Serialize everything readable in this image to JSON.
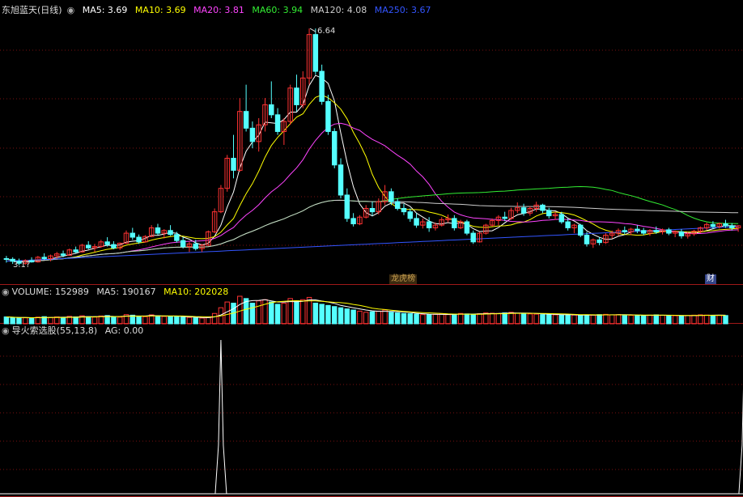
{
  "main_panel": {
    "stock_title": "东旭蓝天(日线)",
    "indicators": [
      {
        "label": "MA5: 3.69",
        "color": "#ffffff"
      },
      {
        "label": "MA10: 3.69",
        "color": "#ffff00"
      },
      {
        "label": "MA20: 3.81",
        "color": "#ff44ff"
      },
      {
        "label": "MA60: 3.94",
        "color": "#33ee33"
      },
      {
        "label": "MA120: 4.08",
        "color": "#cccccc"
      },
      {
        "label": "MA250: 3.67",
        "color": "#3355ff"
      }
    ],
    "high_label": "6.64",
    "low_label": "3.1?",
    "event_tags": [
      {
        "text": "龙虎榜",
        "bar": 62,
        "color": "#c8a050",
        "bg": "#3a2a10"
      },
      {
        "text": "财",
        "bar": 112,
        "color": "#ffffff",
        "bg": "#334488"
      }
    ]
  },
  "volume_panel": {
    "label": "VOLUME: 152989",
    "ma5": "MA5: 190167",
    "ma10": "MA10: 202028"
  },
  "indicator_panel": {
    "label": "导火索选股(55,13,8)",
    "value": "AG: 0.00"
  },
  "colors": {
    "up": "#ff3333",
    "down": "#55ffff",
    "grid": "#7a1010",
    "ag_line": "#ffffff"
  },
  "chart_data": {
    "type": "candlestick",
    "ohlc": [
      [
        3.2,
        3.24,
        3.14,
        3.19
      ],
      [
        3.19,
        3.22,
        3.12,
        3.16
      ],
      [
        3.16,
        3.2,
        3.1,
        3.13
      ],
      [
        3.13,
        3.19,
        3.11,
        3.17
      ],
      [
        3.17,
        3.22,
        3.14,
        3.15
      ],
      [
        3.15,
        3.24,
        3.14,
        3.22
      ],
      [
        3.22,
        3.28,
        3.18,
        3.2
      ],
      [
        3.2,
        3.26,
        3.16,
        3.24
      ],
      [
        3.24,
        3.3,
        3.2,
        3.27
      ],
      [
        3.27,
        3.32,
        3.22,
        3.25
      ],
      [
        3.25,
        3.35,
        3.24,
        3.33
      ],
      [
        3.33,
        3.38,
        3.28,
        3.3
      ],
      [
        3.3,
        3.42,
        3.29,
        3.4
      ],
      [
        3.4,
        3.46,
        3.34,
        3.36
      ],
      [
        3.36,
        3.42,
        3.3,
        3.38
      ],
      [
        3.38,
        3.48,
        3.36,
        3.45
      ],
      [
        3.45,
        3.52,
        3.38,
        3.41
      ],
      [
        3.41,
        3.46,
        3.34,
        3.36
      ],
      [
        3.36,
        3.44,
        3.33,
        3.43
      ],
      [
        3.43,
        3.62,
        3.42,
        3.58
      ],
      [
        3.58,
        3.66,
        3.48,
        3.52
      ],
      [
        3.52,
        3.56,
        3.42,
        3.45
      ],
      [
        3.45,
        3.55,
        3.44,
        3.53
      ],
      [
        3.53,
        3.7,
        3.52,
        3.66
      ],
      [
        3.66,
        3.72,
        3.55,
        3.58
      ],
      [
        3.58,
        3.64,
        3.5,
        3.62
      ],
      [
        3.62,
        3.7,
        3.54,
        3.56
      ],
      [
        3.56,
        3.6,
        3.44,
        3.47
      ],
      [
        3.47,
        3.52,
        3.35,
        3.38
      ],
      [
        3.38,
        3.45,
        3.3,
        3.42
      ],
      [
        3.42,
        3.48,
        3.32,
        3.35
      ],
      [
        3.35,
        3.42,
        3.3,
        3.4
      ],
      [
        3.4,
        3.62,
        3.39,
        3.6
      ],
      [
        3.6,
        3.95,
        3.58,
        3.9
      ],
      [
        3.9,
        4.3,
        3.88,
        4.25
      ],
      [
        4.25,
        4.75,
        4.2,
        4.7
      ],
      [
        4.7,
        5.05,
        4.4,
        4.52
      ],
      [
        4.52,
        5.6,
        4.5,
        5.4
      ],
      [
        5.4,
        5.8,
        5.1,
        5.15
      ],
      [
        5.15,
        5.25,
        4.85,
        4.95
      ],
      [
        4.95,
        5.3,
        4.8,
        5.2
      ],
      [
        5.2,
        5.6,
        5.1,
        5.5
      ],
      [
        5.5,
        5.85,
        5.3,
        5.35
      ],
      [
        5.35,
        5.45,
        5.05,
        5.1
      ],
      [
        5.1,
        5.3,
        4.9,
        5.25
      ],
      [
        5.25,
        5.8,
        5.2,
        5.75
      ],
      [
        5.75,
        5.95,
        5.4,
        5.5
      ],
      [
        5.5,
        6.0,
        5.45,
        5.9
      ],
      [
        5.9,
        6.64,
        5.8,
        6.55
      ],
      [
        6.55,
        6.64,
        5.95,
        6.0
      ],
      [
        6.0,
        6.1,
        5.5,
        5.55
      ],
      [
        5.55,
        5.65,
        5.05,
        5.1
      ],
      [
        5.1,
        5.15,
        4.55,
        4.6
      ],
      [
        4.6,
        4.7,
        4.1,
        4.15
      ],
      [
        4.15,
        4.25,
        3.75,
        3.8
      ],
      [
        3.8,
        3.88,
        3.68,
        3.72
      ],
      [
        3.72,
        3.85,
        3.7,
        3.82
      ],
      [
        3.82,
        4.0,
        3.8,
        3.95
      ],
      [
        3.95,
        4.05,
        3.84,
        3.9
      ],
      [
        3.9,
        4.1,
        3.86,
        4.05
      ],
      [
        4.05,
        4.3,
        4.0,
        4.2
      ],
      [
        4.2,
        4.25,
        4.0,
        4.05
      ],
      [
        4.05,
        4.1,
        3.92,
        3.95
      ],
      [
        3.95,
        4.02,
        3.85,
        3.9
      ],
      [
        3.9,
        3.95,
        3.75,
        3.8
      ],
      [
        3.8,
        3.88,
        3.66,
        3.7
      ],
      [
        3.7,
        3.8,
        3.65,
        3.75
      ],
      [
        3.75,
        3.82,
        3.6,
        3.66
      ],
      [
        3.66,
        3.74,
        3.62,
        3.7
      ],
      [
        3.7,
        3.82,
        3.68,
        3.78
      ],
      [
        3.78,
        3.86,
        3.74,
        3.8
      ],
      [
        3.8,
        3.85,
        3.62,
        3.66
      ],
      [
        3.66,
        3.78,
        3.64,
        3.75
      ],
      [
        3.75,
        3.78,
        3.55,
        3.58
      ],
      [
        3.58,
        3.62,
        3.42,
        3.45
      ],
      [
        3.45,
        3.6,
        3.44,
        3.58
      ],
      [
        3.58,
        3.72,
        3.56,
        3.7
      ],
      [
        3.7,
        3.8,
        3.68,
        3.77
      ],
      [
        3.77,
        3.85,
        3.7,
        3.82
      ],
      [
        3.82,
        3.9,
        3.76,
        3.8
      ],
      [
        3.8,
        3.96,
        3.78,
        3.92
      ],
      [
        3.92,
        4.04,
        3.88,
        3.96
      ],
      [
        3.96,
        4.02,
        3.84,
        3.88
      ],
      [
        3.88,
        3.98,
        3.84,
        3.95
      ],
      [
        3.95,
        4.05,
        3.9,
        4.0
      ],
      [
        4.0,
        4.02,
        3.88,
        3.92
      ],
      [
        3.92,
        3.96,
        3.8,
        3.84
      ],
      [
        3.84,
        3.9,
        3.78,
        3.86
      ],
      [
        3.86,
        3.9,
        3.72,
        3.75
      ],
      [
        3.75,
        3.8,
        3.62,
        3.66
      ],
      [
        3.66,
        3.72,
        3.58,
        3.7
      ],
      [
        3.7,
        3.72,
        3.52,
        3.55
      ],
      [
        3.55,
        3.6,
        3.38,
        3.42
      ],
      [
        3.42,
        3.5,
        3.36,
        3.48
      ],
      [
        3.48,
        3.52,
        3.4,
        3.44
      ],
      [
        3.44,
        3.58,
        3.42,
        3.55
      ],
      [
        3.55,
        3.62,
        3.5,
        3.58
      ],
      [
        3.58,
        3.65,
        3.54,
        3.62
      ],
      [
        3.62,
        3.68,
        3.56,
        3.6
      ],
      [
        3.6,
        3.66,
        3.55,
        3.64
      ],
      [
        3.64,
        3.7,
        3.58,
        3.62
      ],
      [
        3.62,
        3.66,
        3.55,
        3.58
      ],
      [
        3.58,
        3.64,
        3.54,
        3.62
      ],
      [
        3.62,
        3.68,
        3.57,
        3.6
      ],
      [
        3.6,
        3.65,
        3.56,
        3.63
      ],
      [
        3.63,
        3.66,
        3.55,
        3.58
      ],
      [
        3.58,
        3.62,
        3.52,
        3.6
      ],
      [
        3.6,
        3.64,
        3.5,
        3.54
      ],
      [
        3.54,
        3.6,
        3.5,
        3.57
      ],
      [
        3.57,
        3.63,
        3.54,
        3.61
      ],
      [
        3.61,
        3.68,
        3.58,
        3.66
      ],
      [
        3.66,
        3.74,
        3.63,
        3.71
      ],
      [
        3.71,
        3.76,
        3.64,
        3.68
      ],
      [
        3.68,
        3.74,
        3.65,
        3.72
      ],
      [
        3.72,
        3.78,
        3.66,
        3.69
      ],
      [
        3.69,
        3.73,
        3.62,
        3.66
      ],
      [
        3.66,
        3.7,
        3.6,
        3.69
      ]
    ],
    "volume": [
      60,
      55,
      50,
      52,
      48,
      58,
      62,
      55,
      60,
      52,
      65,
      60,
      70,
      62,
      58,
      68,
      72,
      60,
      58,
      80,
      75,
      65,
      62,
      78,
      70,
      64,
      66,
      60,
      58,
      55,
      52,
      50,
      54,
      90,
      140,
      190,
      180,
      240,
      220,
      180,
      200,
      210,
      190,
      170,
      180,
      220,
      200,
      210,
      230,
      180,
      170,
      160,
      150,
      140,
      130,
      120,
      110,
      100,
      105,
      110,
      120,
      100,
      95,
      90,
      88,
      85,
      80,
      78,
      82,
      85,
      80,
      84,
      90,
      86,
      82,
      88,
      95,
      92,
      90,
      95,
      100,
      92,
      88,
      86,
      84,
      80,
      82,
      78,
      75,
      80,
      76,
      72,
      78,
      75,
      80,
      82,
      78,
      80,
      76,
      74,
      72,
      70,
      75,
      78,
      74,
      72,
      70,
      68,
      72,
      75,
      78,
      76,
      74,
      73,
      72
    ],
    "ag_signals": [
      34,
      117
    ],
    "ylim": [
      3.0,
      6.8
    ]
  }
}
